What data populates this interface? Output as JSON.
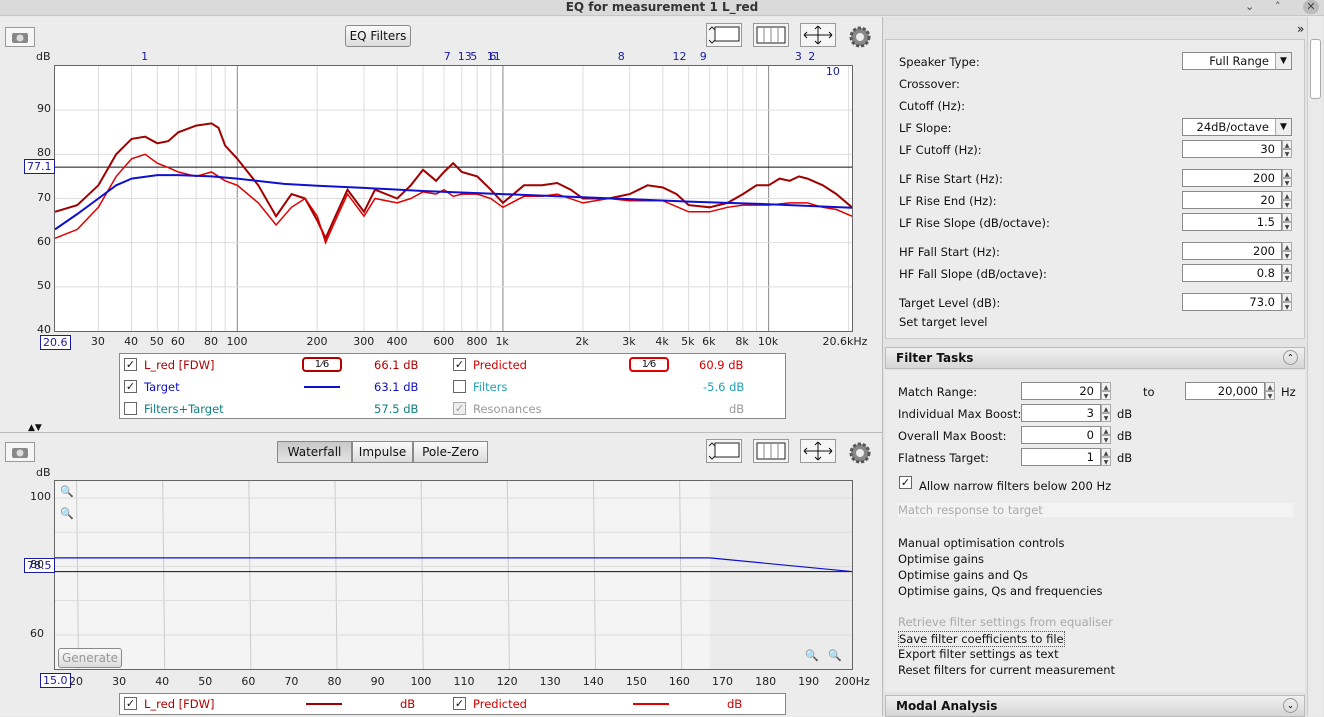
{
  "window": {
    "title": "EQ for measurement 1 L_red",
    "min": "⌄",
    "max": "˄",
    "close": "✕"
  },
  "top_panel": {
    "eq_filters_label": "EQ Filters",
    "y_unit": "dB",
    "y_ticks": [
      "90",
      "80",
      "70",
      "60",
      "50",
      "40"
    ],
    "x_ticks": [
      "30",
      "40",
      "50",
      "60",
      "80",
      "100",
      "200",
      "300",
      "400",
      "600",
      "800",
      "1k",
      "2k",
      "3k",
      "4k",
      "5k",
      "6k",
      "8k",
      "10k",
      "20.6kHz"
    ],
    "x_start": "20.6",
    "target_marker": "77.1",
    "filter_markers": [
      "1",
      "7",
      "13",
      "5",
      "11",
      "6",
      "8",
      "12",
      "9",
      "3",
      "2",
      "10"
    ],
    "legend": {
      "rows": [
        {
          "label": "L_red [FDW]",
          "smoothing": "1⁄6",
          "value": "66.1 dB",
          "checked": "✓"
        },
        {
          "label": "Target",
          "value": "63.1 dB",
          "checked": "✓"
        },
        {
          "label": "Filters+Target",
          "value": "57.5 dB",
          "checked": ""
        },
        {
          "label": "Predicted",
          "smoothing": "1⁄6",
          "value": "60.9 dB",
          "checked": "✓"
        },
        {
          "label": "Filters",
          "value": "-5.6 dB",
          "checked": ""
        },
        {
          "label": "Resonances",
          "value": "dB",
          "checked": "✓"
        }
      ]
    }
  },
  "bottom_panel": {
    "tabs": [
      "Waterfall",
      "Impulse",
      "Pole-Zero"
    ],
    "y_unit": "dB",
    "y_ticks": [
      "100",
      "80",
      "60"
    ],
    "target_marker": "78.5",
    "x_start": "15.0",
    "x_ticks": [
      "20",
      "30",
      "40",
      "50",
      "60",
      "70",
      "80",
      "90",
      "100",
      "110",
      "120",
      "130",
      "140",
      "150",
      "160",
      "170",
      "180",
      "190",
      "200Hz"
    ],
    "generate_label": "Generate",
    "legend": {
      "rows": [
        {
          "label": "L_red [FDW]",
          "value": "dB",
          "checked": "✓"
        },
        {
          "label": "Predicted",
          "value": "dB",
          "checked": "✓"
        }
      ]
    }
  },
  "settings": {
    "speaker_type_label": "Speaker Type:",
    "speaker_type_value": "Full Range",
    "crossover_label": "Crossover:",
    "cutoff_label": "Cutoff (Hz):",
    "lf_slope_label": "LF Slope:",
    "lf_slope_value": "24dB/octave",
    "lf_cutoff_label": "LF Cutoff (Hz):",
    "lf_cutoff_value": "30",
    "lf_rise_start_label": "LF Rise Start (Hz):",
    "lf_rise_start_value": "200",
    "lf_rise_end_label": "LF Rise End (Hz):",
    "lf_rise_end_value": "20",
    "lf_rise_slope_label": "LF Rise Slope (dB/octave):",
    "lf_rise_slope_value": "1.5",
    "hf_fall_start_label": "HF Fall Start (Hz):",
    "hf_fall_start_value": "200",
    "hf_fall_slope_label": "HF Fall Slope (dB/octave):",
    "hf_fall_slope_value": "0.8",
    "target_level_label": "Target Level (dB):",
    "target_level_value": "73.0",
    "set_target_label": "Set target level"
  },
  "filter_tasks": {
    "title": "Filter Tasks",
    "match_range_label": "Match Range:",
    "match_from": "20",
    "to_label": "to",
    "match_to": "20,000",
    "hz_label": "Hz",
    "ind_boost_label": "Individual Max Boost:",
    "ind_boost_value": "3",
    "overall_boost_label": "Overall Max Boost:",
    "overall_boost_value": "0",
    "flatness_label": "Flatness Target:",
    "flatness_value": "1",
    "db_unit": "dB",
    "narrow_label": "Allow narrow filters below 200 Hz",
    "narrow_checked": "✓",
    "match_response": "Match response to target",
    "manual": "Manual optimisation controls",
    "opt_gains": "Optimise gains",
    "opt_gains_q": "Optimise gains and Qs",
    "opt_gains_q_f": "Optimise gains, Qs and frequencies",
    "retrieve": "Retrieve filter settings from equaliser",
    "save_coeffs": "Save filter coefficients to file",
    "export_text": "Export filter settings as text",
    "reset": "Reset filters for current measurement"
  },
  "modal": {
    "title": "Modal Analysis"
  },
  "colors": {
    "measured": "#a00000",
    "predicted": "#e00000",
    "target": "#1010d0",
    "marker": "#1a1aa0"
  }
}
